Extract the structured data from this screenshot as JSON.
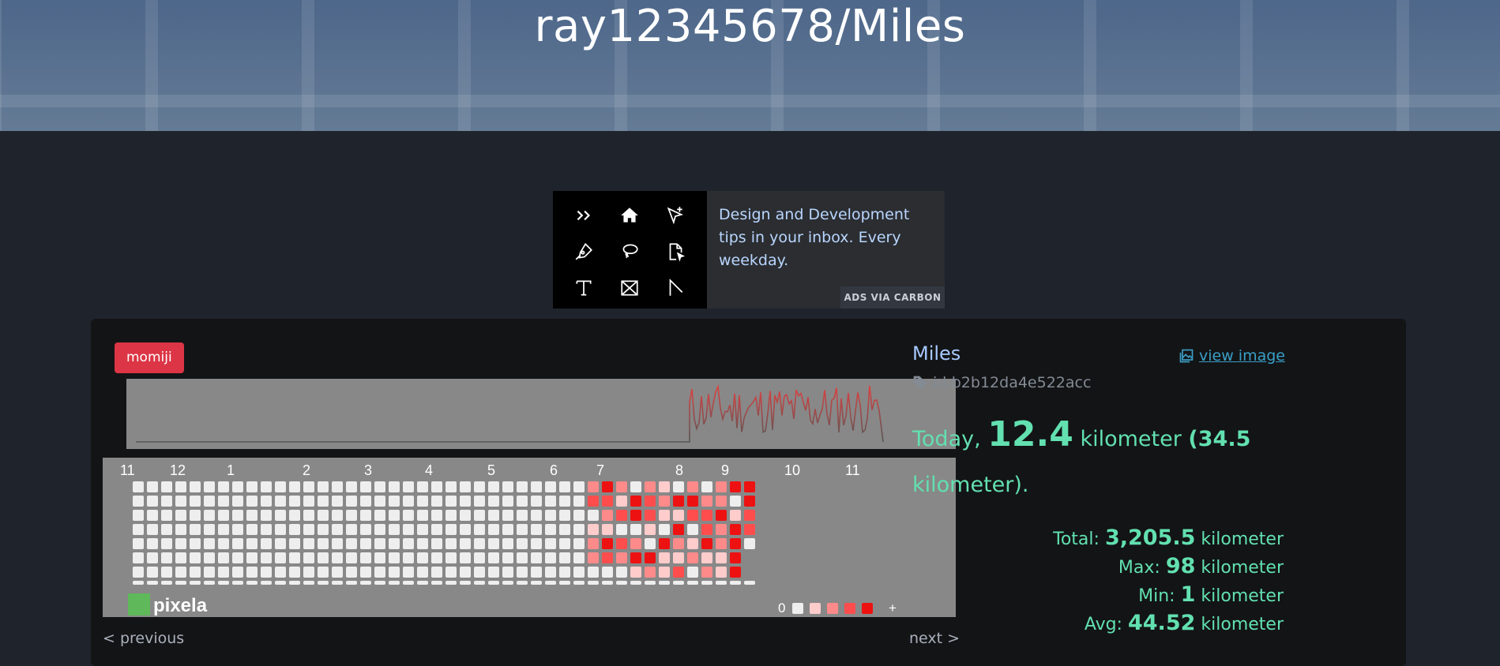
{
  "header": {
    "title": "ray12345678/Miles"
  },
  "ad": {
    "text": "Design and Development tips in your inbox. Every weekday.",
    "label": "ADS VIA CARBON",
    "icons": [
      "chevrons-right-icon",
      "home-icon",
      "cursor-plus-icon",
      "pen-icon",
      "lasso-icon",
      "file-cursor-icon",
      "text-tool-icon",
      "frame-icon",
      "angle-tool-icon"
    ]
  },
  "graph": {
    "tag": "momiji",
    "name": "Miles",
    "view_image_label": "view image",
    "id_label": "id:b2b12da4e522acc",
    "today": {
      "prefix": "Today",
      "comma": ",",
      "value": "12.4",
      "unit": "kilometer",
      "paren_value": "(34.5",
      "paren_unit": "kilometer)."
    },
    "stats": [
      {
        "label": "Total:",
        "value": "3,205.5",
        "unit": "kilometer"
      },
      {
        "label": "Max:",
        "value": "98",
        "unit": "kilometer"
      },
      {
        "label": "Min:",
        "value": "1",
        "unit": "kilometer"
      },
      {
        "label": "Avg:",
        "value": "44.52",
        "unit": "kilometer"
      }
    ],
    "heatmap": {
      "months": [
        "11",
        "12",
        "1",
        "2",
        "3",
        "4",
        "5",
        "6",
        "7",
        "8",
        "9",
        "10",
        "11"
      ],
      "legend_min": "0",
      "legend_max": "+",
      "colors": [
        "#eeeeee",
        "#ffcccc",
        "#ff8a8a",
        "#ff4d4d",
        "#ee1111"
      ],
      "brand": "pixela"
    },
    "line_color": "#e04040",
    "nav": {
      "previous": "< previous",
      "next": "next >"
    }
  }
}
